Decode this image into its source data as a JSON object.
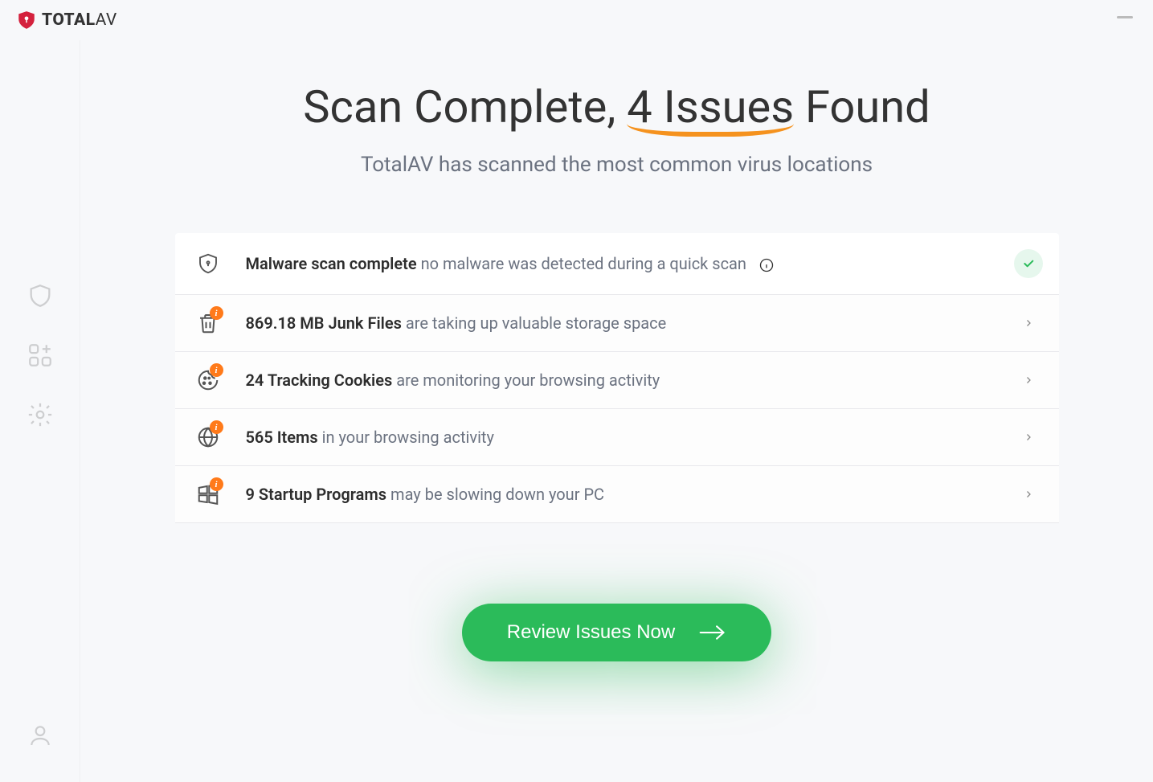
{
  "app": {
    "brand_bold": "TOTAL",
    "brand_light": "AV"
  },
  "heading": {
    "prefix": "Scan Complete, ",
    "highlight": "4 Issues",
    "suffix": " Found"
  },
  "subtitle": "TotalAV has scanned the most common virus locations",
  "rows": {
    "malware": {
      "strong": "Malware scan complete",
      "rest": " no malware was detected during a quick scan"
    },
    "junk": {
      "strong": "869.18 MB Junk Files",
      "rest": " are taking up valuable storage space"
    },
    "cookies": {
      "strong": "24 Tracking Cookies",
      "rest": " are monitoring your browsing activity"
    },
    "browsing": {
      "strong": "565 Items",
      "rest": " in your browsing activity"
    },
    "startup": {
      "strong": "9 Startup Programs",
      "rest": " may be slowing down your PC"
    }
  },
  "cta": "Review Issues Now"
}
